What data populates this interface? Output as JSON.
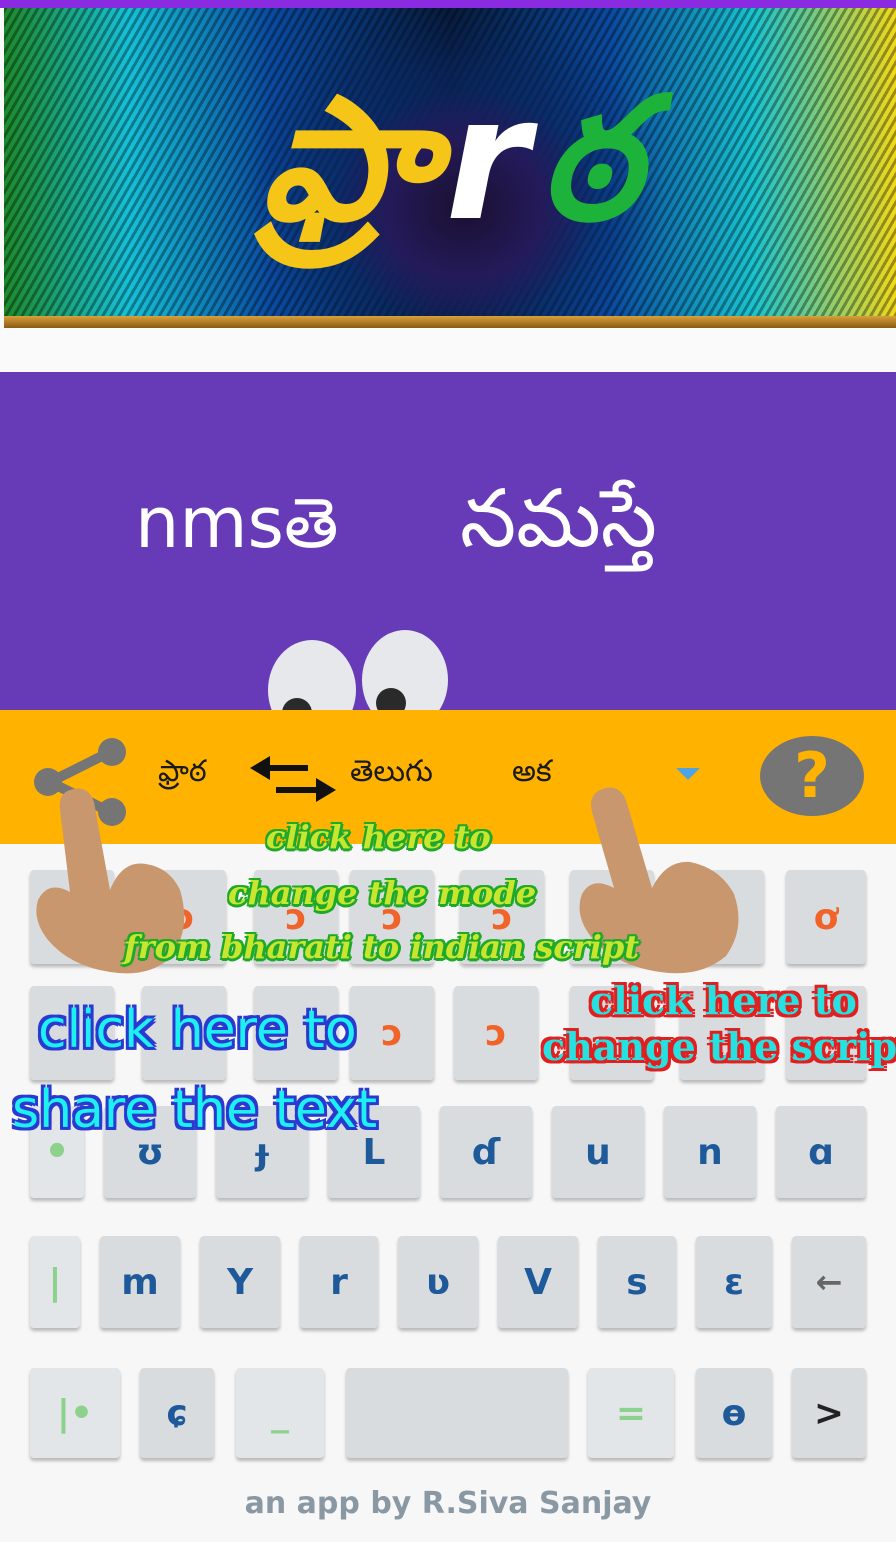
{
  "banner": {
    "logo_part1": "ఫ్రా",
    "logo_part2": "r",
    "logo_part3": "ఠ"
  },
  "display": {
    "bharati_text": "nmsతె",
    "telugu_text": "నమస్తే"
  },
  "toolbar": {
    "source_label": "ఫ్రాఠ",
    "target_label": "తెలుగు",
    "script_label": "అక",
    "help_label": "?"
  },
  "keyboard": {
    "row1": [
      "",
      "ɔ",
      "ɔ",
      "ɔ",
      "ɔ",
      "",
      "",
      "ơ"
    ],
    "row2": [
      "",
      "",
      "",
      "ɔ",
      "ɔ",
      "",
      "",
      ""
    ],
    "row3": [
      "•",
      "ʊ",
      "ɟ",
      "L",
      "ɗ",
      "u",
      "n",
      "ɑ"
    ],
    "row4": [
      "|",
      "m",
      "Y",
      "r",
      "ʋ",
      "V",
      "s",
      "ɛ",
      "←"
    ],
    "row5": [
      "|•",
      "ɕ",
      "_",
      "",
      "=",
      "ɵ",
      ">"
    ]
  },
  "annotations": {
    "mode_line1": "click here to",
    "mode_line2": "change the mode",
    "mode_line3": "from bharati to indian script",
    "script_line1": "click here to",
    "script_line2": "change the script",
    "share_line1": "click here to",
    "share_line2": "share the text"
  },
  "footer": "an app by R.Siva Sanjay",
  "colors": {
    "panel": "#673ab7",
    "toolbar": "#ffb300",
    "key_text": "#1e5a9a"
  }
}
